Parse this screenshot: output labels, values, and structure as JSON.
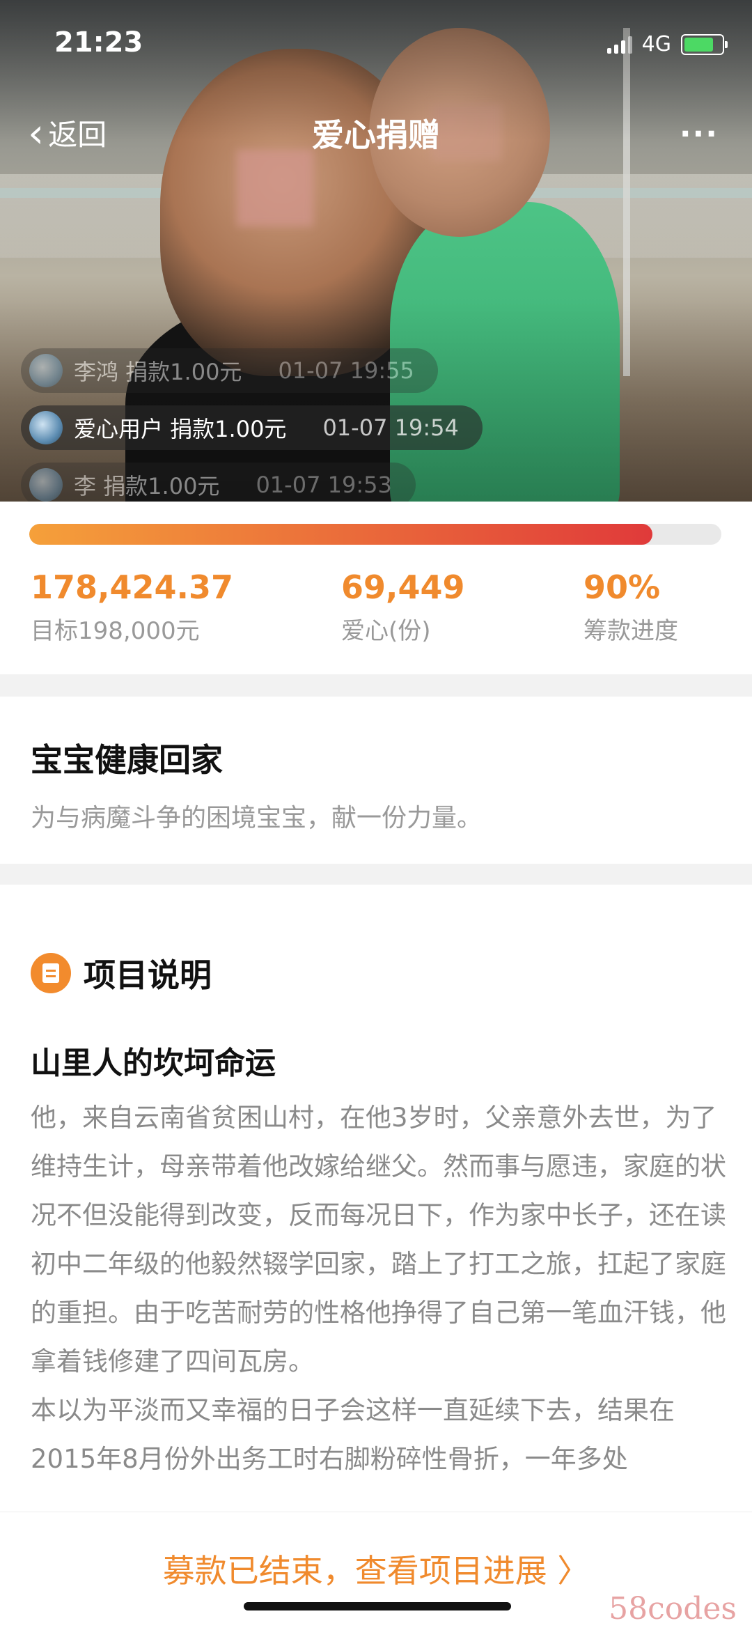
{
  "status_bar": {
    "time": "21:23",
    "network": "4G"
  },
  "nav": {
    "back_label": "返回",
    "title": "爱心捐赠",
    "more": "..."
  },
  "hero": {
    "image_desc_icon": "hero-photo"
  },
  "donation_feed": [
    {
      "text": "李鸿 捐款1.00元",
      "time": "01-07 19:55"
    },
    {
      "text": "爱心用户 捐款1.00元",
      "time": "01-07 19:54"
    },
    {
      "text": "李 捐款1.00元",
      "time": "01-07 19:53"
    }
  ],
  "progress": {
    "fraction": 0.9,
    "raised": "178,424.37",
    "target_label": "目标198,000元",
    "hearts": "69,449",
    "hearts_label": "爱心(份)",
    "percent": "90%",
    "percent_label": "筹款进度"
  },
  "project": {
    "title": "宝宝健康回家",
    "subtitle": "为与病魔斗争的困境宝宝，献一份力量。"
  },
  "section": {
    "title": "项目说明",
    "story_title": "山里人的坎坷命运"
  },
  "story_paragraphs": [
    "他，来自云南省贫困山村，在他3岁时，父亲意外去世，为了维持生计，母亲带着他改嫁给继父。然而事与愿违，家庭的状况不但没能得到改变，反而每况日下，作为家中长子，还在读初中二年级的他毅然辍学回家，踏上了打工之旅，扛起了家庭的重担。由于吃苦耐劳的性格他挣得了自己第一笔血汗钱，他拿着钱修建了四间瓦房。",
    "本以为平淡而又幸福的日子会这样一直延续下去，结果在2015年8月份外出务工时右脚粉碎性骨折，一年多处"
  ],
  "footer": {
    "cta": "募款已结束，查看项目进展 〉"
  },
  "watermark": "58codes",
  "colors": {
    "accent": "#f08a2d",
    "bar_start": "#f5a03a",
    "bar_end": "#e03a3a"
  }
}
